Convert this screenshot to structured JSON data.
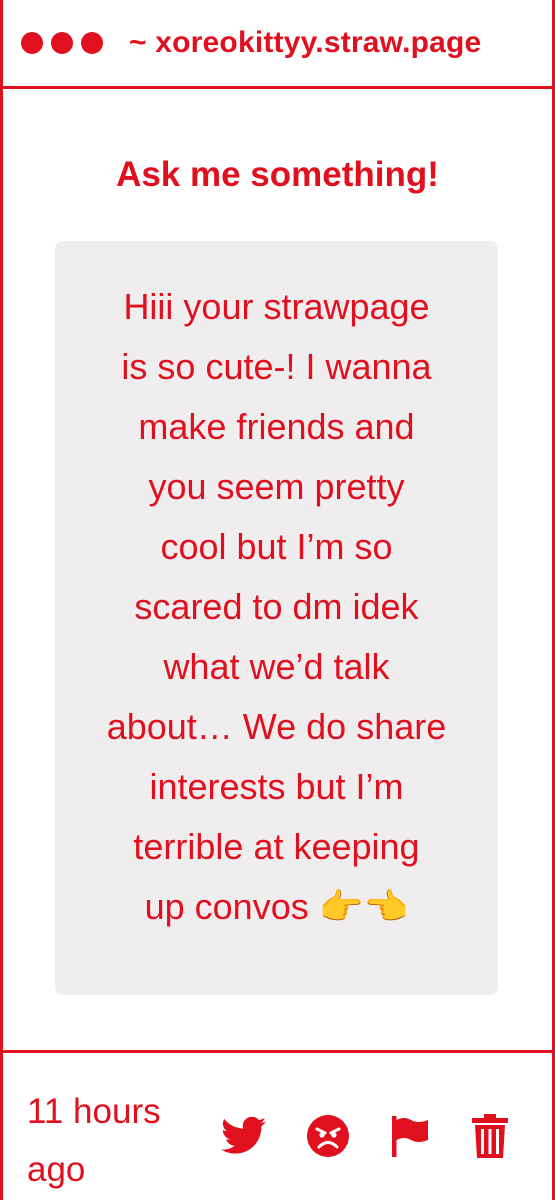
{
  "window": {
    "url": "~ xoreokittyy.straw.page",
    "accent_color": "#e0101e",
    "card_background": "#efedee"
  },
  "main": {
    "heading": "Ask me something!",
    "question_lines": [
      "Hiii your strawpage",
      "is so cute-! I wanna",
      "make friends and",
      "you seem pretty",
      "cool but I’m so",
      "scared to dm idek",
      "what we’d talk",
      "about… We do share",
      "interests but I’m",
      "terrible at keeping",
      "up convos 👉👈"
    ]
  },
  "footer": {
    "timestamp": "11 hours ago",
    "actions": [
      {
        "icon": "twitter-bird-icon"
      },
      {
        "icon": "angry-face-icon"
      },
      {
        "icon": "flag-icon"
      },
      {
        "icon": "trash-icon"
      }
    ]
  }
}
